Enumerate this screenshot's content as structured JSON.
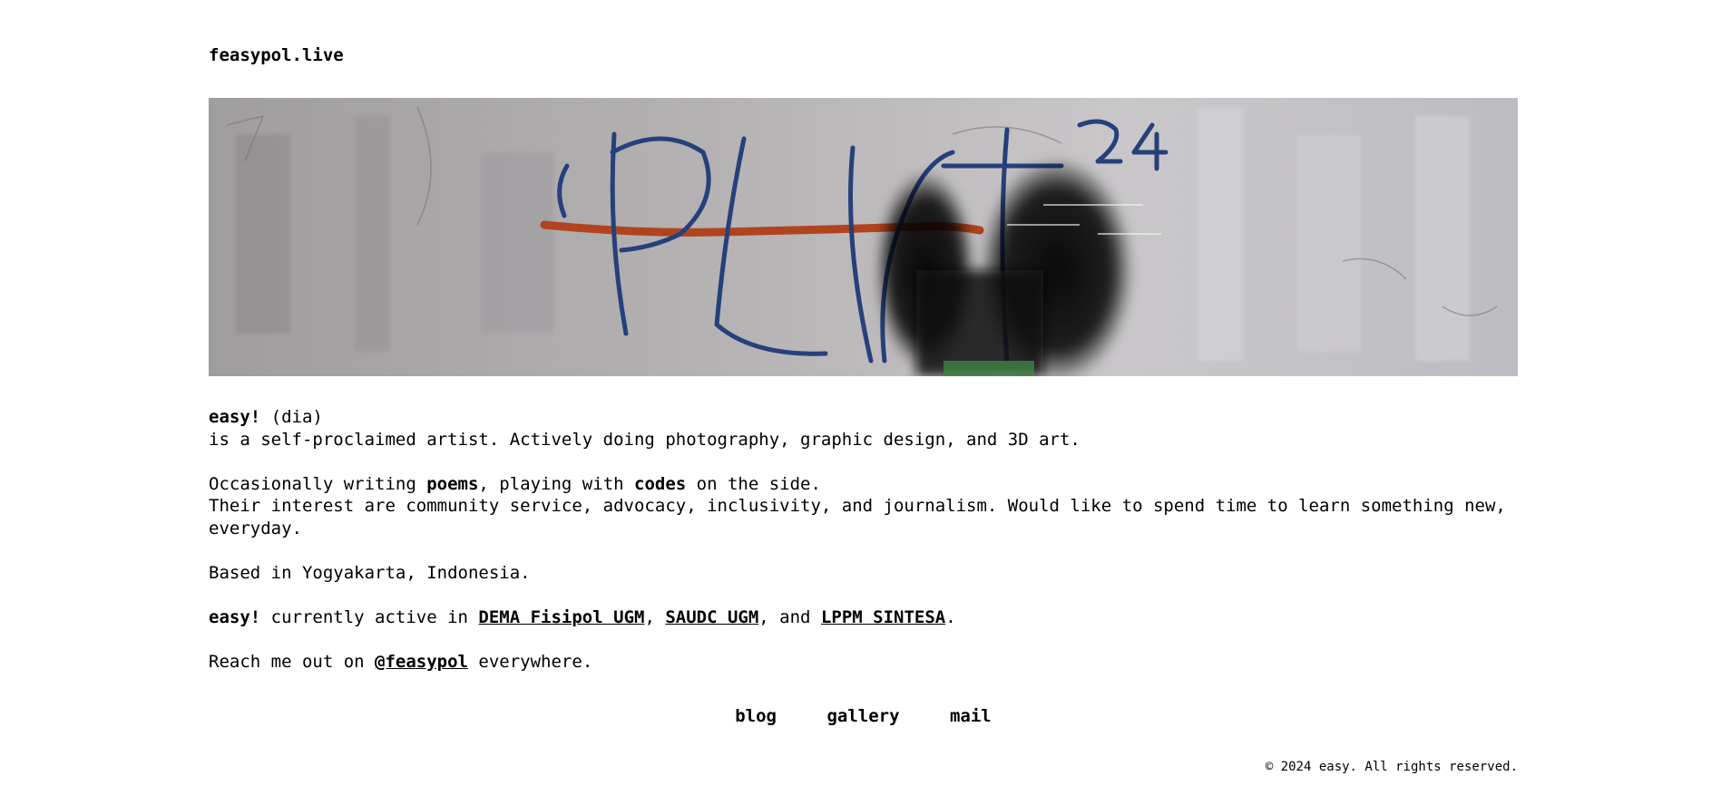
{
  "header": {
    "site_title": "feasypol.live"
  },
  "banner": {
    "graffiti_text": "PLIT",
    "superscript": "24"
  },
  "bio": {
    "line1_name": "easy!",
    "line1_pronoun": " (dia)",
    "line2": "is a self-proclaimed artist. Actively doing photography, graphic design, and 3D art.",
    "line3_a": "Occasionally writing ",
    "line3_poems": "poems",
    "line3_b": ", playing with ",
    "line3_codes": "codes",
    "line3_c": " on the side.",
    "line4": "Their interest are community service, advocacy, inclusivity, and journalism. Would like to spend time to learn something new, everyday.",
    "line5": "Based in Yogyakarta, Indonesia.",
    "line6_name": "easy!",
    "line6_a": " currently active in ",
    "link_dema": "DEMA Fisipol UGM",
    "sep1": ", ",
    "link_saudc": "SAUDC UGM",
    "sep2": ", and ",
    "link_lppm": "LPPM SINTESA",
    "line6_end": ".",
    "line7_a": "Reach me out on ",
    "link_handle": "@feasypol",
    "line7_b": " everywhere."
  },
  "nav": {
    "blog": "blog",
    "gallery": "gallery",
    "mail": "mail"
  },
  "footer": {
    "copyright": "© 2024 easy. All rights reserved."
  }
}
